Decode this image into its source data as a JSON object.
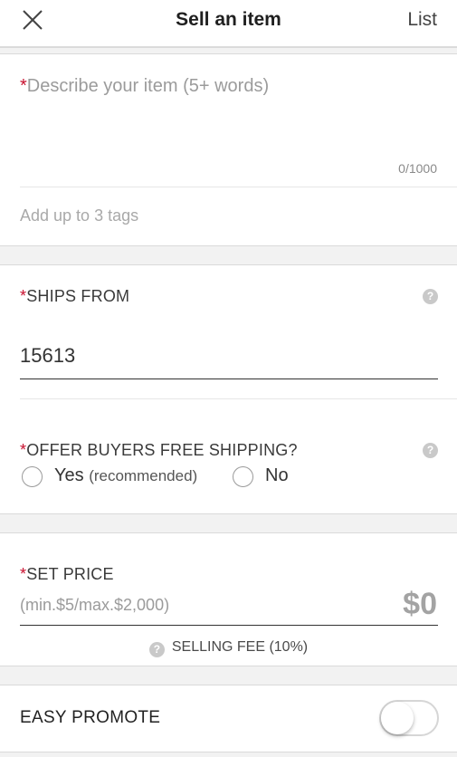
{
  "header": {
    "title": "Sell an item",
    "list_label": "List",
    "close_icon": "close-icon"
  },
  "description": {
    "required_mark": "*",
    "placeholder": "Describe your item (5+ words)",
    "counter": "0/1000",
    "tags_placeholder": "Add up to 3 tags"
  },
  "ships_from": {
    "required_mark": "*",
    "label": "SHIPS FROM",
    "zip": "15613",
    "help_icon": "?"
  },
  "free_shipping": {
    "required_mark": "*",
    "label": "OFFER BUYERS FREE SHIPPING?",
    "help_icon": "?",
    "options": [
      {
        "label": "Yes",
        "note": "(recommended)",
        "selected": false
      },
      {
        "label": "No",
        "note": "",
        "selected": false
      }
    ]
  },
  "price": {
    "required_mark": "*",
    "label": "SET PRICE",
    "hint": "(min.$5/max.$2,000)",
    "value": "$0",
    "fee_label": "SELLING FEE (10%)",
    "help_icon": "?"
  },
  "promote": {
    "label": "EASY PROMOTE",
    "enabled": false
  },
  "colors": {
    "required": "#c8102e",
    "band": "#f2f2f2"
  }
}
